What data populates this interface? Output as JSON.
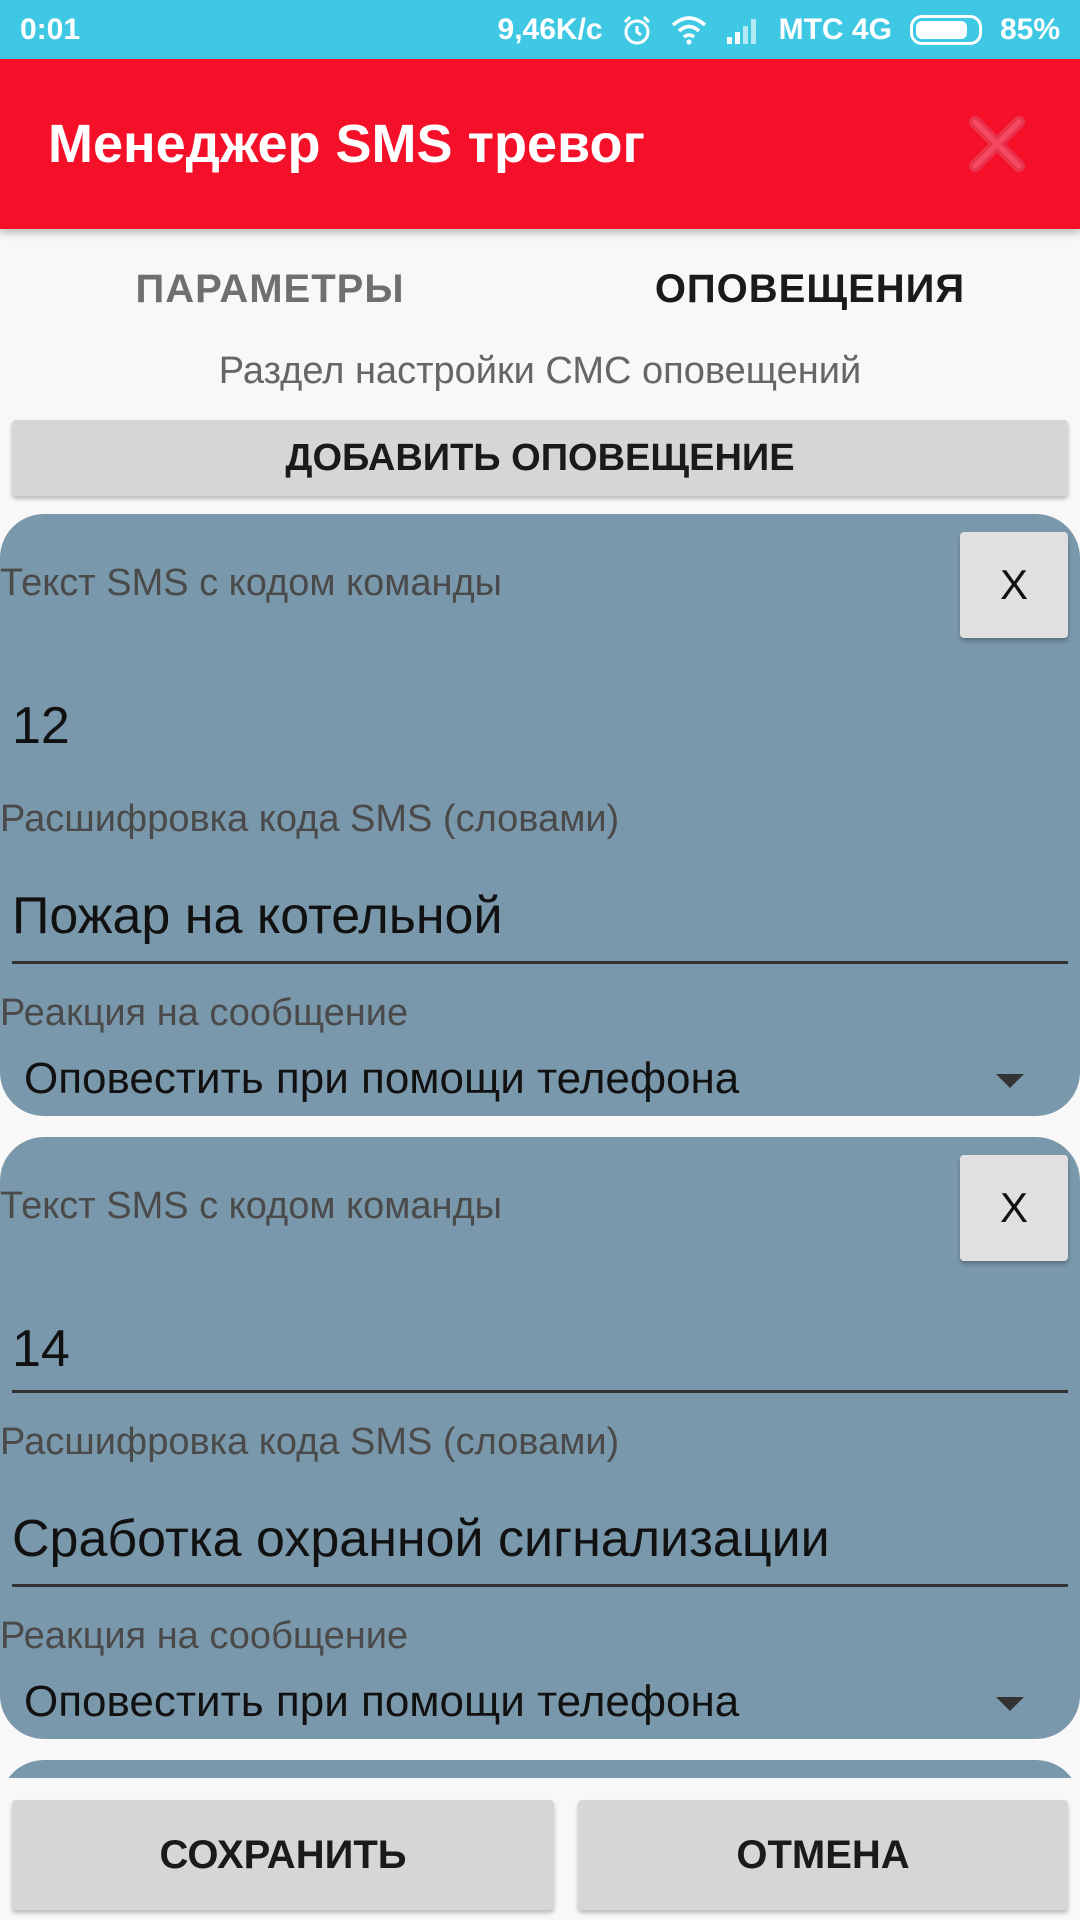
{
  "status_bar": {
    "time": "0:01",
    "speed": "9,46K/c",
    "carrier": "МТС 4G",
    "battery": "85%",
    "icons": [
      "alarm-icon",
      "wifi-icon",
      "signal-icon",
      "battery-icon"
    ],
    "bg_color": "#3fc8e4"
  },
  "app_bar": {
    "title": "Менеджер SMS тревог",
    "close_icon": "close-icon",
    "bg_color": "#f5102a"
  },
  "tabs": [
    {
      "label": "ПАРАМЕТРЫ",
      "active": false
    },
    {
      "label": "ОПОВЕЩЕНИЯ",
      "active": true
    }
  ],
  "section": {
    "caption": "Раздел настройки СМС оповещений",
    "add_button": "ДОБАВИТЬ ОПОВЕЩЕНИЕ"
  },
  "alerts": [
    {
      "code_label": "Текст SMS с кодом команды",
      "code_value": "12",
      "remove_label": "X",
      "desc_label": "Расшифровка кода SMS (словами)",
      "desc_value": "Пожар на котельной",
      "reaction_label": "Реакция на сообщение",
      "reaction_value": "Оповестить при помощи телефона"
    },
    {
      "code_label": "Текст SMS с кодом команды",
      "code_value": "14",
      "remove_label": "X",
      "desc_label": "Расшифровка кода SMS (словами)",
      "desc_value": "Сработка охранной сигнализации",
      "reaction_label": "Реакция на сообщение",
      "reaction_value": "Оповестить при помощи телефона"
    }
  ],
  "footer": {
    "save": "СОХРАНИТЬ",
    "cancel": "ОТМЕНА"
  },
  "colors": {
    "card": "#7a98ab",
    "button": "#d6d6d6"
  }
}
